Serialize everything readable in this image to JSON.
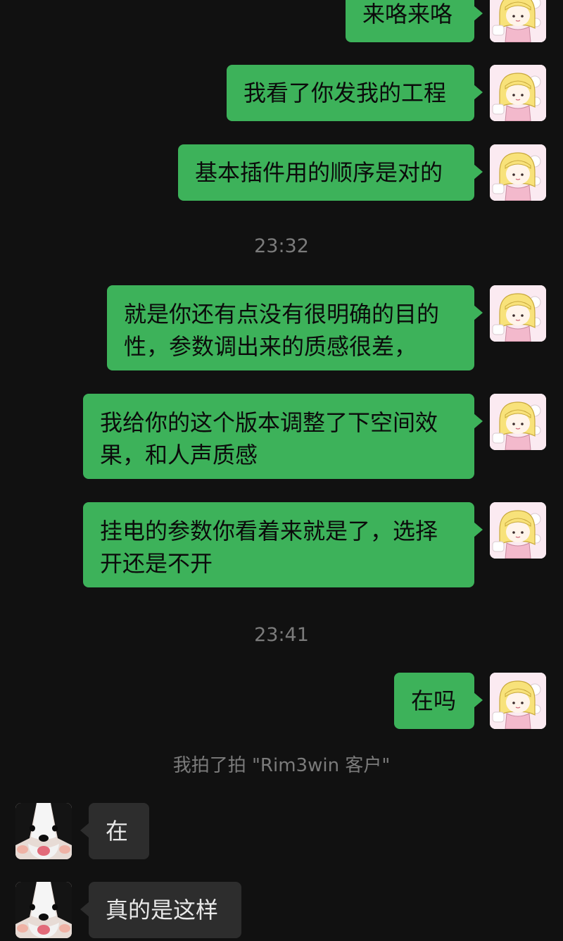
{
  "messages": [
    {
      "id": "m1",
      "text": "来咯来咯"
    },
    {
      "id": "m2",
      "text": "我看了你发我的工程"
    },
    {
      "id": "m3",
      "text": "基本插件用的顺序是对的"
    },
    {
      "id": "m4",
      "text": "就是你还有点没有很明确的目的性，参数调出来的质感很差，"
    },
    {
      "id": "m5",
      "text": "我给你的这个版本调整了下空间效果，和人声质感"
    },
    {
      "id": "m6",
      "text": "挂电的参数你看着来就是了，选择开还是不开"
    },
    {
      "id": "m7",
      "text": "在吗"
    },
    {
      "id": "m8",
      "text": "在"
    },
    {
      "id": "m9",
      "text": "真的是这样"
    }
  ],
  "timestamps": [
    "23:32",
    "23:41"
  ],
  "system": {
    "pat": "我拍了拍 \"Rim3win 客户\""
  },
  "colors": {
    "background": "#111111",
    "my_bubble": "#3db25a",
    "other_bubble": "#2d2d2d",
    "meta_text": "#7b7b7b"
  },
  "icons": {
    "my_avatar": "cartoon-girl-avatar",
    "other_avatar": "dog-avatar"
  }
}
